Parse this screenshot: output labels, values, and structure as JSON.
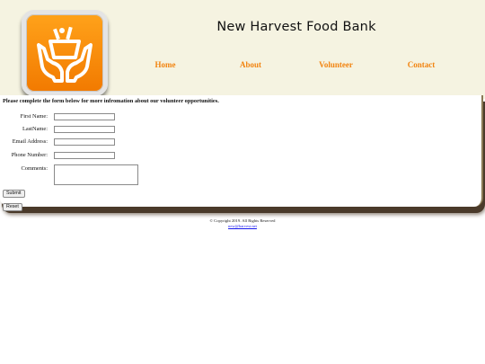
{
  "header": {
    "site_title": "New Harvest Food Bank",
    "logo_icon": "harvest-box-hands-icon",
    "logo_colors": {
      "fill": "#f58a07",
      "frame": "#e4e4e4"
    }
  },
  "nav": {
    "items": [
      {
        "label": "Home"
      },
      {
        "label": "About"
      },
      {
        "label": "Volunteer"
      },
      {
        "label": "Contact"
      }
    ],
    "color": "#f2830f"
  },
  "form": {
    "intro": "Please complete the form below for more infromation about our volunteer opportunities.",
    "fields": {
      "first_name": {
        "label": "First Name:",
        "value": ""
      },
      "last_name": {
        "label": "LastName:",
        "value": ""
      },
      "email": {
        "label": "Email Address:",
        "value": ""
      },
      "phone": {
        "label": "Phone Number:",
        "value": ""
      },
      "comments": {
        "label": "Comments:",
        "value": ""
      }
    },
    "submit_label": "Submit",
    "reset_label": "Reset"
  },
  "footer": {
    "copyright": "© Copyright 2019. All Rights Reserved",
    "email": "new@harvest.net"
  },
  "colors": {
    "header_bg": "#f5f3e1",
    "shadow": "#4a3a2a"
  }
}
